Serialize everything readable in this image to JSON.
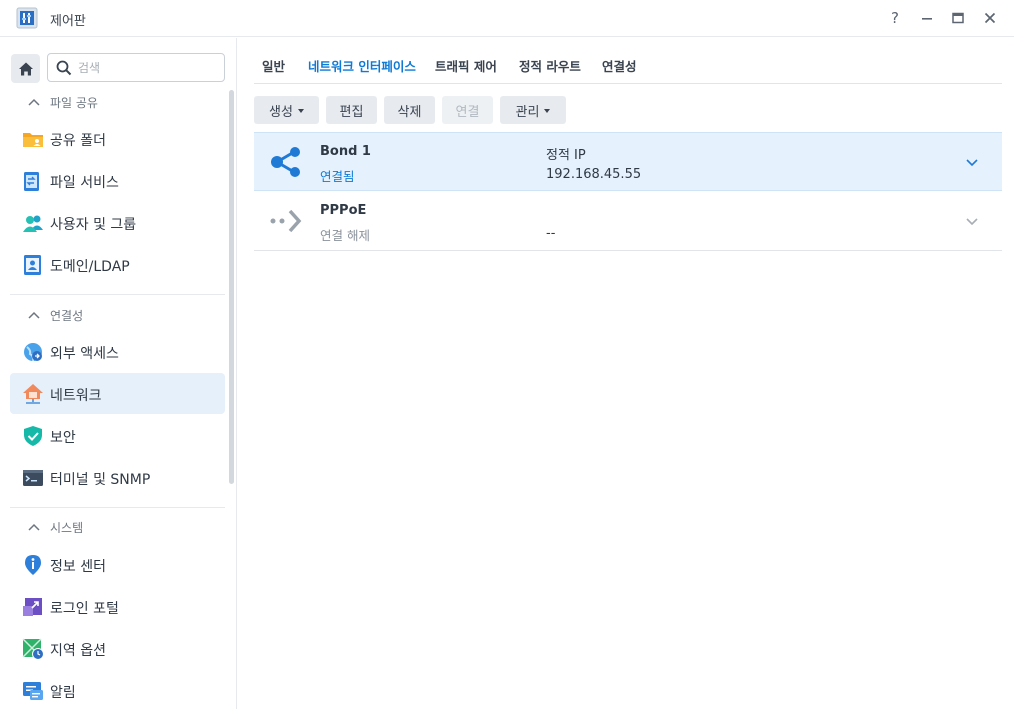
{
  "window": {
    "title": "제어판",
    "help": "?",
    "minimize": "—",
    "maximize": "□",
    "close": "✕"
  },
  "sidebar": {
    "search_placeholder": "검색",
    "sections": [
      {
        "title": "파일 공유",
        "items": [
          {
            "label": "공유 폴더",
            "icon": "shared-folder-icon"
          },
          {
            "label": "파일 서비스",
            "icon": "file-services-icon"
          },
          {
            "label": "사용자 및 그룹",
            "icon": "users-groups-icon"
          },
          {
            "label": "도메인/LDAP",
            "icon": "domain-ldap-icon"
          }
        ]
      },
      {
        "title": "연결성",
        "items": [
          {
            "label": "외부 액세스",
            "icon": "external-access-icon"
          },
          {
            "label": "네트워크",
            "icon": "network-icon",
            "active": true
          },
          {
            "label": "보안",
            "icon": "security-shield-icon"
          },
          {
            "label": "터미널 및 SNMP",
            "icon": "terminal-icon"
          }
        ]
      },
      {
        "title": "시스템",
        "items": [
          {
            "label": "정보 센터",
            "icon": "info-center-icon"
          },
          {
            "label": "로그인 포털",
            "icon": "login-portal-icon"
          },
          {
            "label": "지역 옵션",
            "icon": "regional-options-icon"
          },
          {
            "label": "알림",
            "icon": "notification-icon"
          }
        ]
      }
    ]
  },
  "tabs": [
    {
      "label": "일반"
    },
    {
      "label": "네트워크 인터페이스",
      "active": true
    },
    {
      "label": "트래픽 제어"
    },
    {
      "label": "정적 라우트"
    },
    {
      "label": "연결성"
    }
  ],
  "toolbar": {
    "create": "생성",
    "edit": "편집",
    "delete": "삭제",
    "connect": "연결",
    "manage": "관리"
  },
  "interfaces": [
    {
      "name": "Bond 1",
      "status": "연결됨",
      "ip_type": "정적 IP",
      "ip": "192.168.45.55",
      "icon": "bond-share-icon"
    },
    {
      "name": "PPPoE",
      "status": "연결 해제",
      "ip_type": "",
      "ip": "--",
      "icon": "pppoe-arrow-icon"
    }
  ],
  "colors": {
    "accent": "#0e7ad6",
    "selected_row": "#e5f1fc",
    "active_nav": "#e6f0fb",
    "connected": "#0e7ad6",
    "disconnected": "#8a929b"
  }
}
